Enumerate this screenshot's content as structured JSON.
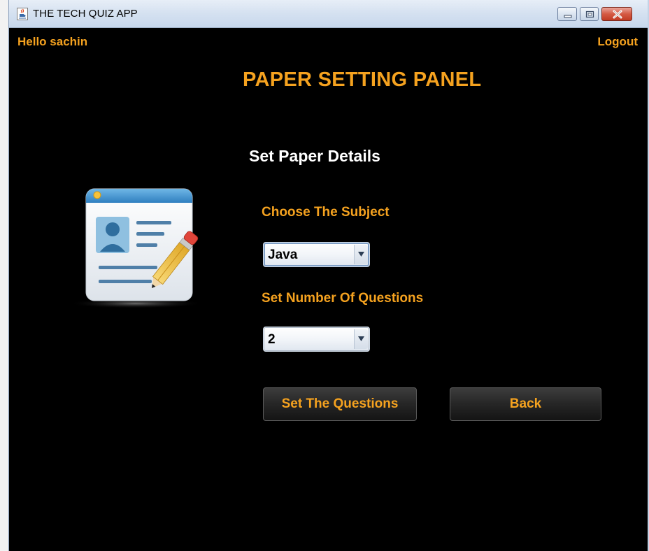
{
  "window": {
    "title": "THE TECH QUIZ APP"
  },
  "header": {
    "greeting": "Hello sachin",
    "logout_label": "Logout"
  },
  "panel": {
    "title": "PAPER SETTING PANEL",
    "section_heading": "Set Paper Details"
  },
  "form": {
    "subject_label": "Choose The Subject",
    "subject_value": "Java",
    "questions_label": "Set Number Of Questions",
    "questions_value": "2"
  },
  "actions": {
    "set_questions_label": "Set The Questions",
    "back_label": "Back"
  },
  "icons": {
    "app": "java-cup-icon",
    "illustration": "profile-card-pencil-icon",
    "dropdown": "chevron-down-icon"
  },
  "colors": {
    "accent": "#f5a21f",
    "background": "#000000",
    "heading": "#ffffff"
  }
}
